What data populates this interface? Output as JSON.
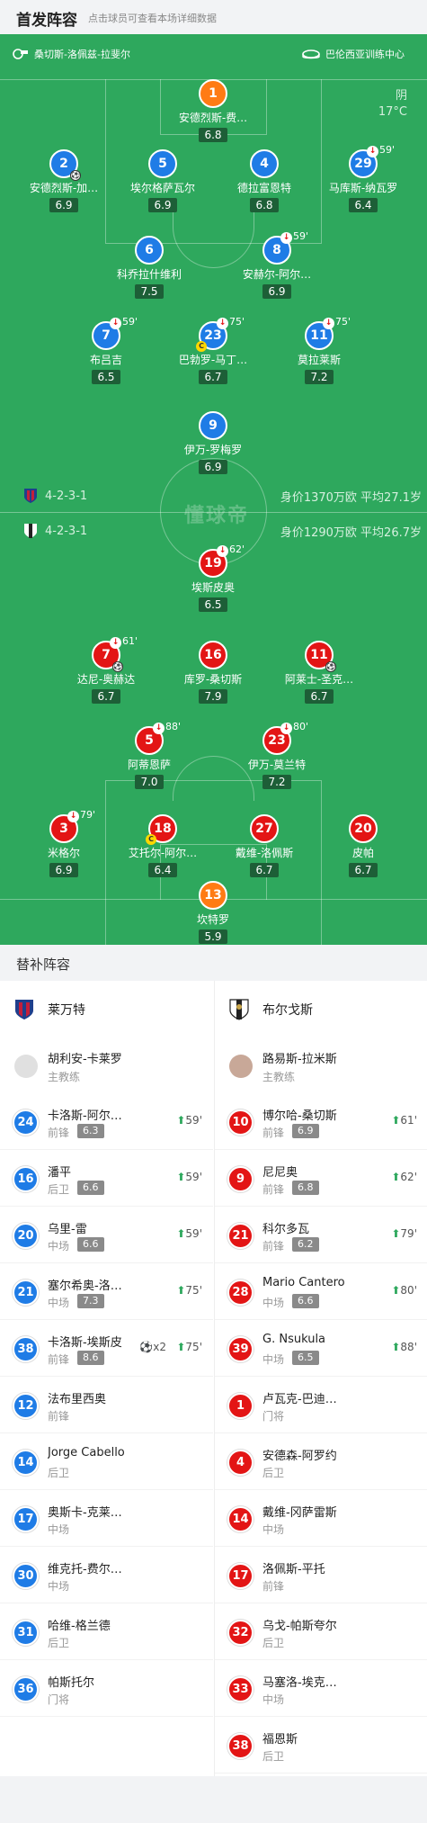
{
  "header": {
    "title": "首发阵容",
    "subtitle": "点击球员可查看本场详细数据"
  },
  "pitch": {
    "referee": "桑切斯-洛佩兹-拉斐尔",
    "stadium": "巴伦西亚训练中心",
    "weather": "阴",
    "temperature": "17°C",
    "watermark": "懂球帝",
    "home_formation": "4-2-3-1",
    "home_value": "身价1370万欧 平均27.1岁",
    "away_formation": "4-2-3-1",
    "away_value": "身价1290万欧 平均26.7岁",
    "home_players": [
      {
        "num": "1",
        "name": "安德烈斯-费…",
        "rating": "6.8"
      },
      {
        "num": "2",
        "name": "安德烈斯-加…",
        "rating": "6.9"
      },
      {
        "num": "5",
        "name": "埃尔格萨瓦尔",
        "rating": "6.9"
      },
      {
        "num": "4",
        "name": "德拉富恩特",
        "rating": "6.8"
      },
      {
        "num": "29",
        "name": "马库斯-纳瓦罗",
        "rating": "6.4",
        "sub": "59'"
      },
      {
        "num": "6",
        "name": "科乔拉什维利",
        "rating": "7.5"
      },
      {
        "num": "8",
        "name": "安赫尔-阿尔…",
        "rating": "6.9",
        "sub": "59'"
      },
      {
        "num": "7",
        "name": "布吕吉",
        "rating": "6.5",
        "sub": "59'"
      },
      {
        "num": "23",
        "name": "巴勃罗-马丁…",
        "rating": "6.7",
        "sub": "75'"
      },
      {
        "num": "11",
        "name": "莫拉莱斯",
        "rating": "7.2",
        "sub": "75'"
      },
      {
        "num": "9",
        "name": "伊万-罗梅罗",
        "rating": "6.9"
      }
    ],
    "away_players": [
      {
        "num": "19",
        "name": "埃斯皮奥",
        "rating": "6.5",
        "sub": "62'"
      },
      {
        "num": "7",
        "name": "达尼-奥赫达",
        "rating": "6.7",
        "sub": "61'"
      },
      {
        "num": "16",
        "name": "库罗-桑切斯",
        "rating": "7.9"
      },
      {
        "num": "11",
        "name": "阿莱士-圣克…",
        "rating": "6.7"
      },
      {
        "num": "5",
        "name": "阿蒂恩萨",
        "rating": "7.0",
        "sub": "88'"
      },
      {
        "num": "23",
        "name": "伊万-莫兰特",
        "rating": "7.2",
        "sub": "80'"
      },
      {
        "num": "3",
        "name": "米格尔",
        "rating": "6.9",
        "sub": "79'"
      },
      {
        "num": "18",
        "name": "艾托尔-阿尔…",
        "rating": "6.4"
      },
      {
        "num": "27",
        "name": "戴维-洛佩斯",
        "rating": "6.7"
      },
      {
        "num": "20",
        "name": "皮帕",
        "rating": "6.7"
      },
      {
        "num": "13",
        "name": "坎特罗",
        "rating": "5.9"
      }
    ]
  },
  "subs": {
    "title": "替补阵容",
    "home": {
      "team": "莱万特",
      "coach": {
        "name": "胡利安-卡莱罗",
        "role": "主教练"
      },
      "players": [
        {
          "num": "24",
          "name": "卡洛斯-阿尔…",
          "pos": "前锋",
          "rating": "6.3",
          "min": "59'"
        },
        {
          "num": "16",
          "name": "潘平",
          "pos": "后卫",
          "rating": "6.6",
          "min": "59'"
        },
        {
          "num": "20",
          "name": "乌里-雷",
          "pos": "中场",
          "rating": "6.6",
          "min": "59'"
        },
        {
          "num": "21",
          "name": "塞尔希奥-洛…",
          "pos": "中场",
          "rating": "7.3",
          "min": "75'"
        },
        {
          "num": "38",
          "name": "卡洛斯-埃斯皮",
          "pos": "前锋",
          "rating": "8.6",
          "min": "75'",
          "goals": "x2"
        },
        {
          "num": "12",
          "name": "法布里西奥",
          "pos": "前锋"
        },
        {
          "num": "14",
          "name": "Jorge Cabello",
          "pos": "后卫"
        },
        {
          "num": "17",
          "name": "奥斯卡-克莱…",
          "pos": "中场"
        },
        {
          "num": "30",
          "name": "维克托-费尔…",
          "pos": "中场"
        },
        {
          "num": "31",
          "name": "哈维-格兰德",
          "pos": "后卫"
        },
        {
          "num": "36",
          "name": "帕斯托尔",
          "pos": "门将"
        }
      ]
    },
    "away": {
      "team": "布尔戈斯",
      "coach": {
        "name": "路易斯-拉米斯",
        "role": "主教练"
      },
      "players": [
        {
          "num": "10",
          "name": "博尔哈-桑切斯",
          "pos": "前锋",
          "rating": "6.9",
          "min": "61'"
        },
        {
          "num": "9",
          "name": "尼尼奥",
          "pos": "前锋",
          "rating": "6.8",
          "min": "62'"
        },
        {
          "num": "21",
          "name": "科尔多瓦",
          "pos": "前锋",
          "rating": "6.2",
          "min": "79'"
        },
        {
          "num": "28",
          "name": "Mario Cantero",
          "pos": "中场",
          "rating": "6.6",
          "min": "80'"
        },
        {
          "num": "39",
          "name": "G. Nsukula",
          "pos": "中场",
          "rating": "6.5",
          "min": "88'"
        },
        {
          "num": "1",
          "name": "卢瓦克-巴迪…",
          "pos": "门将"
        },
        {
          "num": "4",
          "name": "安德森-阿罗约",
          "pos": "后卫"
        },
        {
          "num": "14",
          "name": "戴维-冈萨雷斯",
          "pos": "中场"
        },
        {
          "num": "17",
          "name": "洛佩斯-平托",
          "pos": "前锋"
        },
        {
          "num": "32",
          "name": "乌戈-帕斯夸尔",
          "pos": "后卫"
        },
        {
          "num": "33",
          "name": "马塞洛-埃克…",
          "pos": "中场"
        },
        {
          "num": "38",
          "name": "福恩斯",
          "pos": "后卫"
        }
      ]
    }
  },
  "colors": {
    "pitch": "#2ea85d",
    "home": "#1f7ce6",
    "away": "#e31515",
    "keeper": "#ff7b14"
  }
}
